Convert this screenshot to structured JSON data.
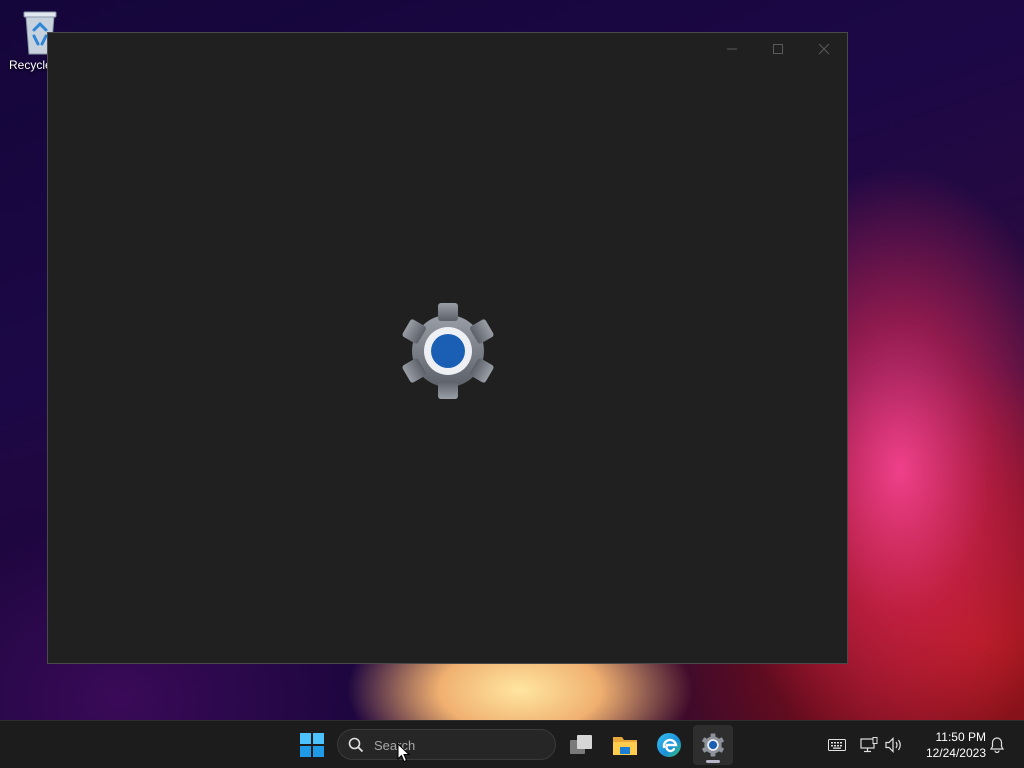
{
  "desktop": {
    "recycle_bin_label": "Recycle"
  },
  "window": {
    "title": "",
    "splash_icon": "settings-gear-icon",
    "controls": [
      "minimize-icon",
      "maximize-icon",
      "close-icon"
    ]
  },
  "taskbar": {
    "start_icon": "windows-start-icon",
    "search": {
      "placeholder": "Search",
      "value": ""
    },
    "apps": [
      {
        "name": "task-view-icon"
      },
      {
        "name": "file-explorer-icon"
      },
      {
        "name": "edge-browser-icon"
      },
      {
        "name": "settings-icon",
        "active": true
      }
    ],
    "tray": {
      "icons": [
        "keyboard-icon",
        "network-icon",
        "volume-icon",
        "notification-bell-icon"
      ],
      "time": "11:50 PM",
      "date": "12/24/2023"
    }
  },
  "colors": {
    "window_bg": "#202020",
    "taskbar_bg": "#1c1c1c",
    "accent_blue": "#1a5fb4"
  }
}
